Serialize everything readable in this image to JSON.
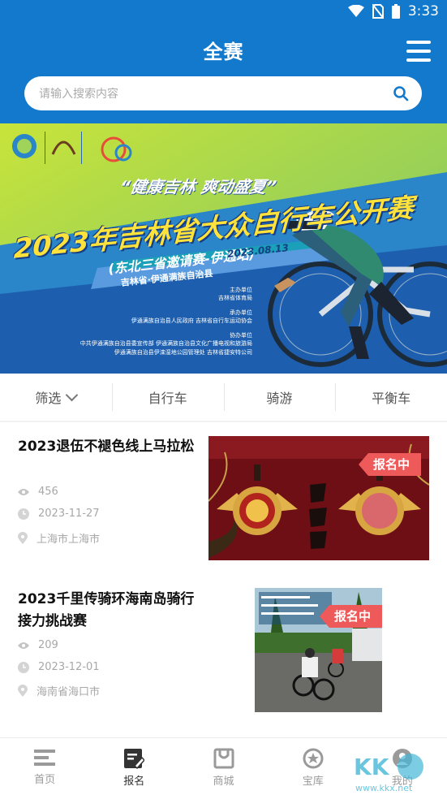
{
  "status": {
    "time": "3:33"
  },
  "header": {
    "title": "全赛",
    "menu_icon": "hamburger-menu-icon"
  },
  "search": {
    "placeholder": "请输入搜索内容"
  },
  "banner": {
    "slogan": "“健康吉林 爽动盛夏”",
    "title": "2023年吉林省大众自行车公开赛",
    "subtitle": "(东北三省邀请赛-伊通站)",
    "date": "2023.08.13",
    "ribbon": "吉林省·伊通满族自治县",
    "organizers": [
      "主办单位",
      "吉林省体育局",
      "承办单位",
      "伊通满族自治县人民政府  吉林省自行车运动协会",
      "协办单位",
      "中共伊通满族自治县委宣传部  伊通满族自治县文化广播电视和旅游局",
      "伊通满族自治县伊滦湿地公园管理处  吉林省捷安特公司"
    ]
  },
  "filters": [
    {
      "label": "筛选"
    },
    {
      "label": "自行车"
    },
    {
      "label": "骑游"
    },
    {
      "label": "平衡车"
    }
  ],
  "events": [
    {
      "title": "2023退伍不褪色线上马拉松",
      "views": "456",
      "date": "2023-11-27",
      "location": "上海市上海市",
      "badge": "报名中"
    },
    {
      "title": "2023千里传骑环海南岛骑行接力挑战赛",
      "views": "209",
      "date": "2023-12-01",
      "location": "海南省海口市",
      "badge": "报名中"
    }
  ],
  "tabs": [
    {
      "label": "首页",
      "icon": "home-icon"
    },
    {
      "label": "报名",
      "icon": "signup-icon"
    },
    {
      "label": "商城",
      "icon": "shop-icon"
    },
    {
      "label": "宝库",
      "icon": "treasure-icon"
    },
    {
      "label": "我的",
      "icon": "profile-icon"
    }
  ],
  "colors": {
    "primary": "#1279cc",
    "badge": "#ee5a5a"
  }
}
